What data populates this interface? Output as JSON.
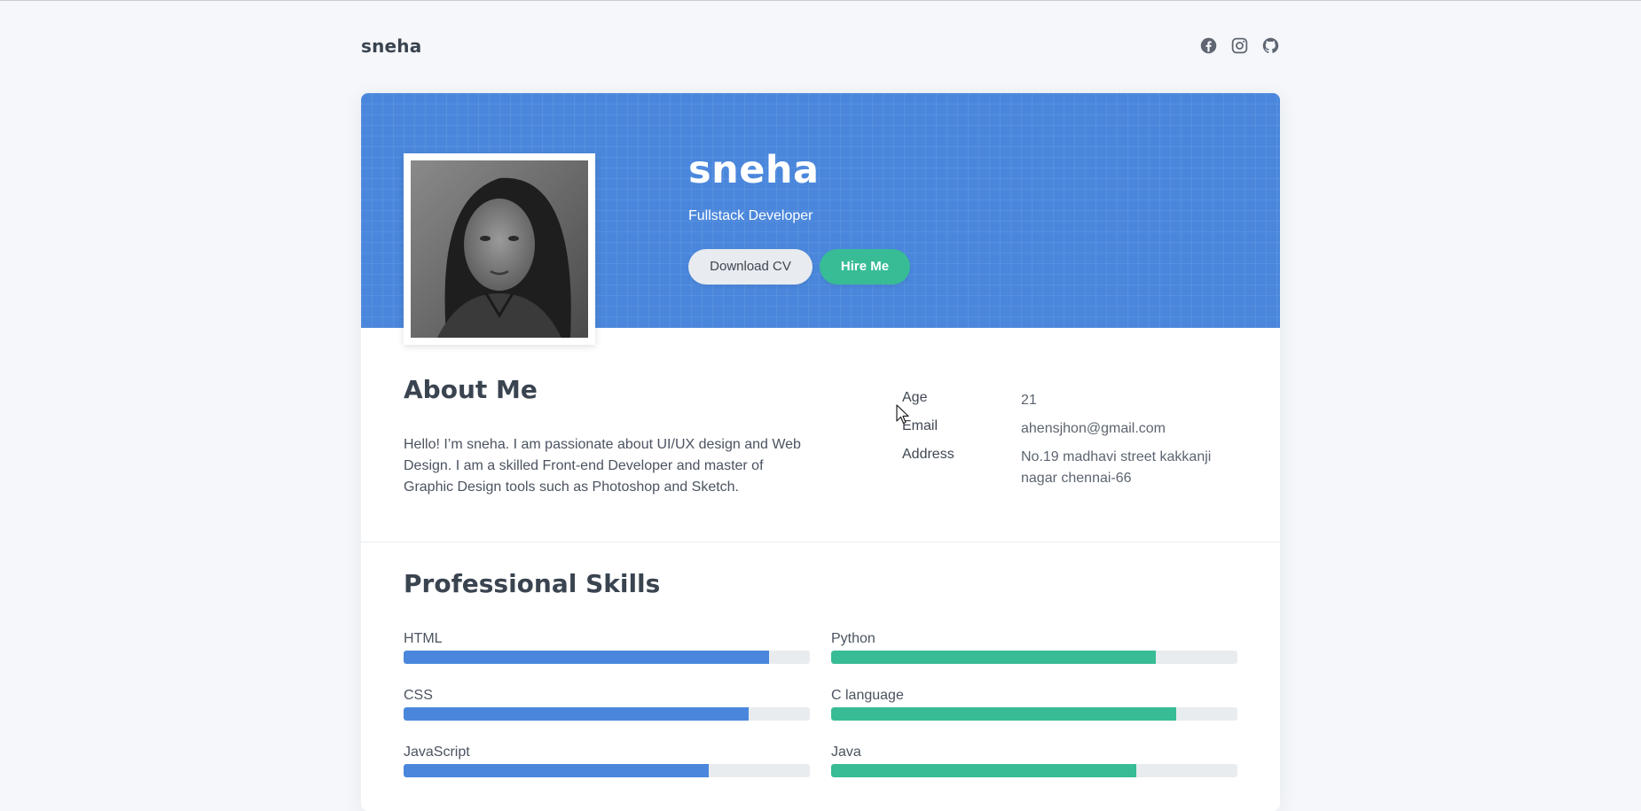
{
  "header": {
    "brand": "sneha",
    "social": [
      {
        "icon": "facebook-icon"
      },
      {
        "icon": "instagram-icon"
      },
      {
        "icon": "github-icon"
      }
    ]
  },
  "hero": {
    "name": "sneha",
    "role": "Fullstack Developer",
    "download_label": "Download CV",
    "hire_label": "Hire Me",
    "photo_alt": "Profile photo",
    "accent": "#4a87dc",
    "hire_color": "#37bc96"
  },
  "about": {
    "title": "About Me",
    "text": "Hello! I’m sneha. I am passionate about UI/UX design and Web Design. I am a skilled Front-end Developer and master of Graphic Design tools such as Photoshop and Sketch.",
    "info": [
      {
        "label": "Age",
        "value": "21"
      },
      {
        "label": "Email",
        "value": "ahensjhon@gmail.com"
      },
      {
        "label": "Address",
        "value": "No.19 madhavi street kakkanji nagar chennai-66"
      }
    ]
  },
  "skills": {
    "title": "Professional Skills",
    "left": [
      {
        "label": "HTML",
        "level": 0.9
      },
      {
        "label": "CSS",
        "level": 0.85
      },
      {
        "label": "JavaScript",
        "level": 0.75
      }
    ],
    "right": [
      {
        "label": "Python",
        "level": 0.8
      },
      {
        "label": "C language",
        "level": 0.85
      },
      {
        "label": "Java",
        "level": 0.75
      }
    ],
    "left_color": "#4a87dc",
    "right_color": "#37bc96"
  }
}
